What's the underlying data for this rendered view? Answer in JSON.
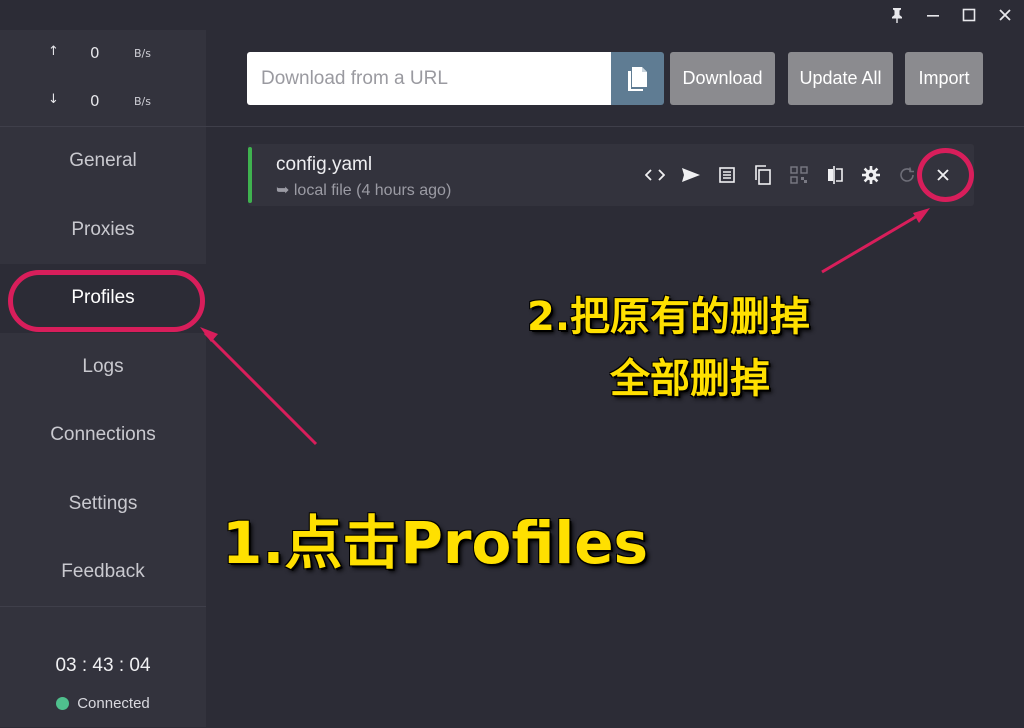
{
  "traffic": {
    "up_arrow": "↑",
    "up_value": "0",
    "up_unit": "B/s",
    "down_arrow": "↓",
    "down_value": "0",
    "down_unit": "B/s"
  },
  "sidebar": {
    "items": [
      {
        "label": "General"
      },
      {
        "label": "Proxies"
      },
      {
        "label": "Profiles"
      },
      {
        "label": "Logs"
      },
      {
        "label": "Connections"
      },
      {
        "label": "Settings"
      },
      {
        "label": "Feedback"
      }
    ],
    "active": "Profiles",
    "clock": "03 : 43 : 04",
    "status": "Connected",
    "status_color": "#4fc08d"
  },
  "toolbar": {
    "url_placeholder": "Download from a URL",
    "download_label": "Download",
    "update_all_label": "Update All",
    "import_label": "Import"
  },
  "profile": {
    "name": "config.yaml",
    "arrow": "➥",
    "source": "local file (4 hours ago)",
    "active_color": "#3fb24f"
  },
  "annotations": {
    "step1": "1.点击Profiles",
    "step2_line1": "2.把原有的删掉",
    "step2_line2": "全部删掉",
    "highlight_color": "#d81e5b",
    "text_color": "#ffe000"
  },
  "window": {
    "icons": [
      "pin-icon",
      "minimize-icon",
      "maximize-icon",
      "close-icon"
    ]
  }
}
